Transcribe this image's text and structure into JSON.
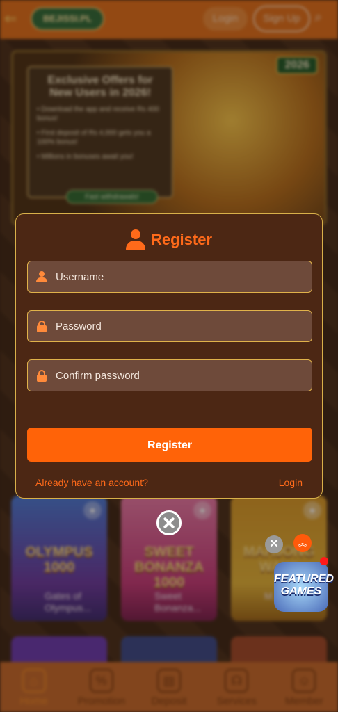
{
  "header": {
    "logo_text": "BEJISSI.PL",
    "login_label": "Login",
    "signup_label": "Sign Up"
  },
  "banner": {
    "title": "Exclusive Offers for New Users in 2026!",
    "lines": [
      "• Download the app and receive Rs 400 bonus!",
      "• First deposit of Rs 4,000 gets you a 100% bonus!",
      "• Millions in bonuses await you!"
    ],
    "button": "Fast withdrawals!",
    "year": "2026"
  },
  "modal": {
    "title": "Register",
    "username_placeholder": "Username",
    "password_placeholder": "Password",
    "confirm_placeholder": "Confirm password",
    "register_label": "Register",
    "footer_text": "Already have an account?",
    "login_link": "Login"
  },
  "games": [
    {
      "art": "OLYMPUS 1000",
      "name": "Gates of Olympus..."
    },
    {
      "art": "SWEET BONANZA 1000",
      "name": "Sweet Bonanza..."
    },
    {
      "art": "MAHJONG WAYS",
      "name": "M... W..."
    }
  ],
  "featured": {
    "badge": "FEATURED GAMES"
  },
  "bottom_nav": {
    "items": [
      {
        "label": "Home",
        "icon": "home-icon"
      },
      {
        "label": "Promotion",
        "icon": "gift-icon"
      },
      {
        "label": "Deposit",
        "icon": "wallet-icon"
      },
      {
        "label": "Services",
        "icon": "headset-icon"
      },
      {
        "label": "Member",
        "icon": "member-icon"
      }
    ]
  },
  "colors": {
    "accent": "#ff6308",
    "modal_bg": "#4c2714",
    "field_bg": "#6e4a3a",
    "border_gold": "#d8b04a",
    "topbar": "#e0701c"
  }
}
